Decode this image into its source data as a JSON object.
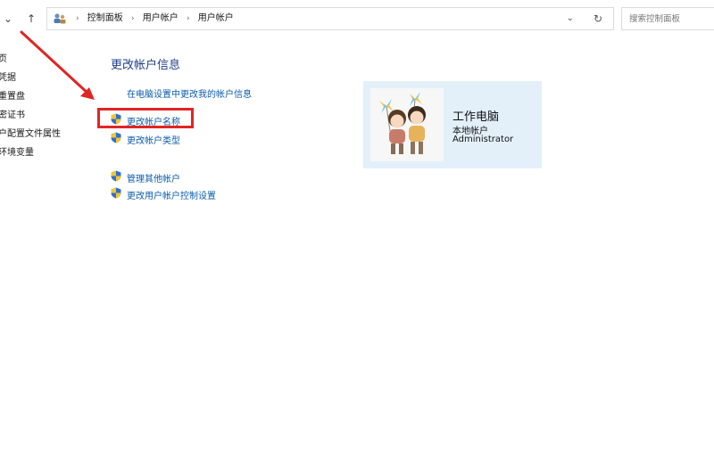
{
  "nav": {
    "back_glyph": "⌄",
    "up_glyph": "↑"
  },
  "address_bar": {
    "icon": "control-panel-icon",
    "crumbs": [
      "控制面板",
      "用户帐户",
      "用户帐户"
    ],
    "separator": "›",
    "dropdown_glyph": "⌄",
    "refresh_glyph": "↻"
  },
  "search": {
    "placeholder": "搜索控制面板"
  },
  "left_pane": {
    "items": [
      "主页",
      "党凭据",
      "理重置盘",
      "加密证书",
      "用户配置文件属性",
      "改环境变量"
    ]
  },
  "main": {
    "title": "更改帐户信息",
    "link_pc_settings": "在电脑设置中更改我的帐户信息",
    "link_change_name": "更改帐户名称",
    "link_change_type": "更改帐户类型",
    "link_manage_other": "管理其他帐户",
    "link_uac_settings": "更改用户帐户控制设置"
  },
  "account": {
    "name": "工作电脑",
    "type": "本地帐户",
    "role": "Administrator"
  },
  "colors": {
    "link": "#0b5cad",
    "title": "#1e3f8a",
    "card_bg": "#e3f0fa",
    "annotation_red": "#e02525"
  }
}
